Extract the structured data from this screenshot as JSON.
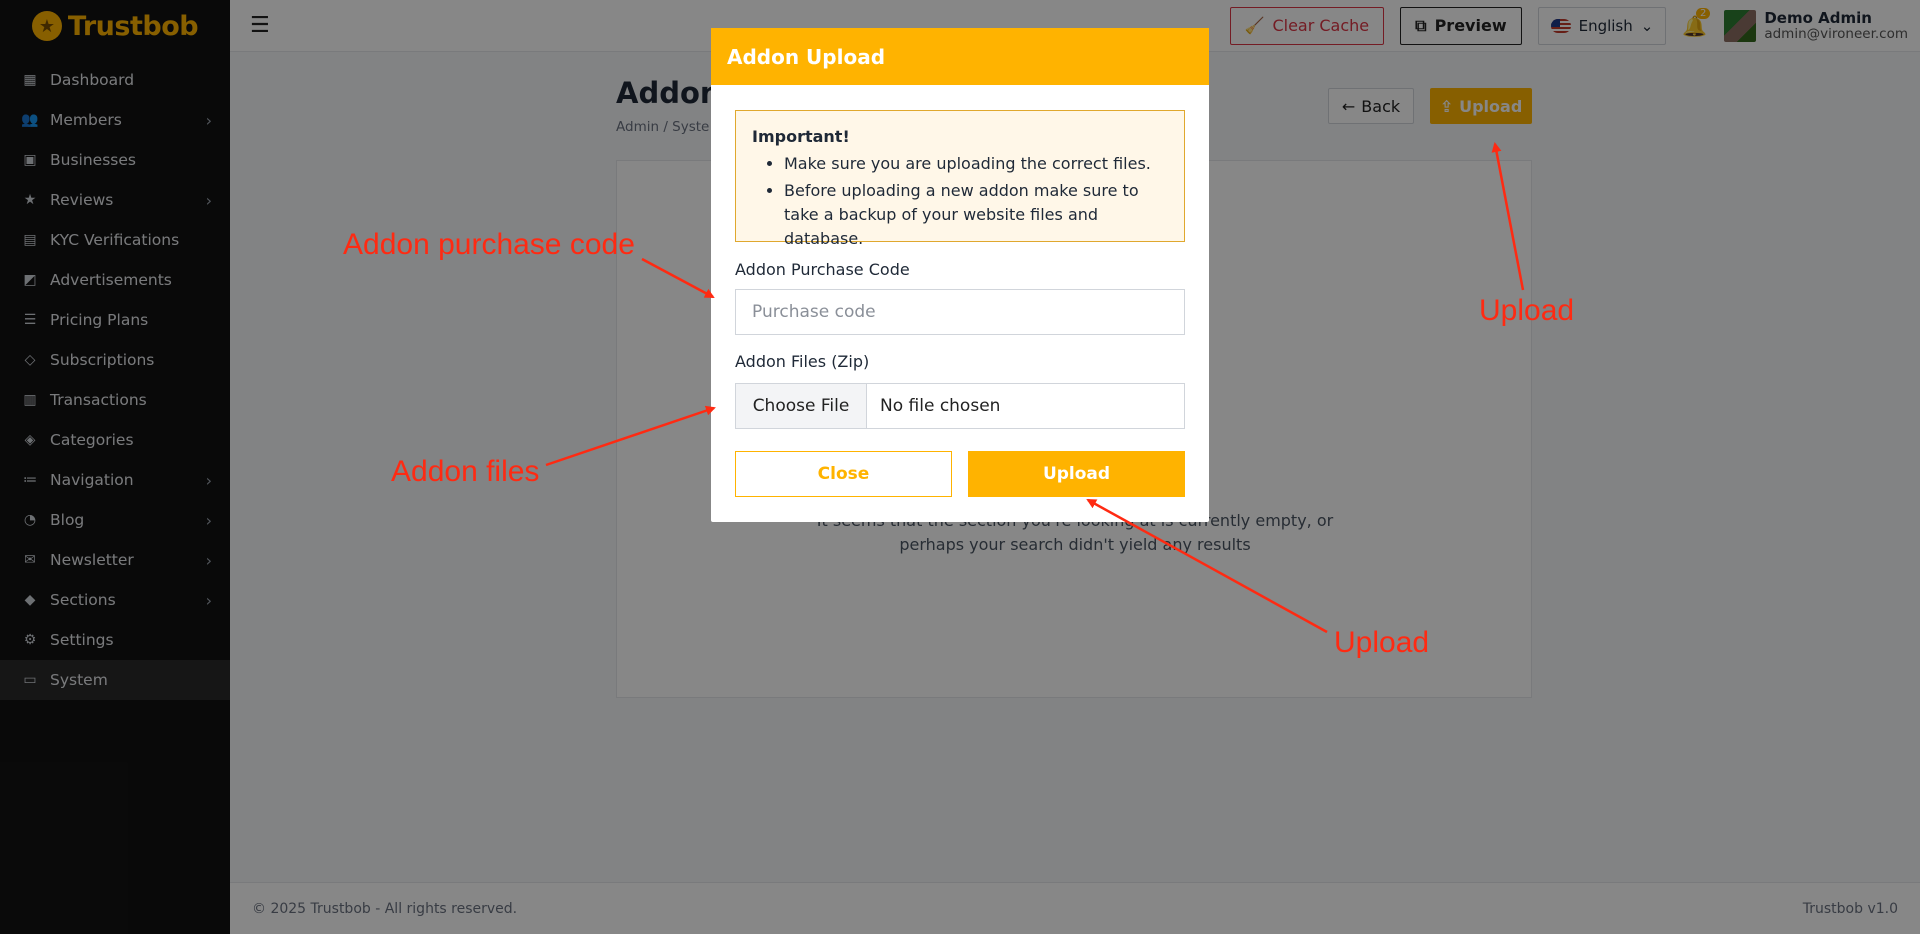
{
  "brand": {
    "name_part1": "Trust",
    "name_part2": "bob"
  },
  "sidebar": {
    "items": [
      {
        "label": "Dashboard",
        "icon": "dashboard-icon",
        "chevron": false
      },
      {
        "label": "Members",
        "icon": "users-icon",
        "chevron": true
      },
      {
        "label": "Businesses",
        "icon": "briefcase-icon",
        "chevron": false
      },
      {
        "label": "Reviews",
        "icon": "star-icon",
        "chevron": true
      },
      {
        "label": "KYC Verifications",
        "icon": "id-card-icon",
        "chevron": false
      },
      {
        "label": "Advertisements",
        "icon": "ad-icon",
        "chevron": false
      },
      {
        "label": "Pricing Plans",
        "icon": "price-list-icon",
        "chevron": false
      },
      {
        "label": "Subscriptions",
        "icon": "gem-icon",
        "chevron": false
      },
      {
        "label": "Transactions",
        "icon": "receipt-icon",
        "chevron": false
      },
      {
        "label": "Categories",
        "icon": "tags-icon",
        "chevron": false
      },
      {
        "label": "Navigation",
        "icon": "list-icon",
        "chevron": true
      },
      {
        "label": "Blog",
        "icon": "rss-icon",
        "chevron": true
      },
      {
        "label": "Newsletter",
        "icon": "mail-icon",
        "chevron": true
      },
      {
        "label": "Sections",
        "icon": "layers-icon",
        "chevron": true
      },
      {
        "label": "Settings",
        "icon": "gear-icon",
        "chevron": false
      },
      {
        "label": "System",
        "icon": "server-icon",
        "chevron": false,
        "active": true
      }
    ]
  },
  "topbar": {
    "clear_cache": "Clear Cache",
    "preview": "Preview",
    "language": "English",
    "notification_count": "2",
    "user_name": "Demo Admin",
    "user_email": "admin@vironeer.com"
  },
  "page": {
    "title": "Addon",
    "breadcrumb": "Admin  /  Syste",
    "back": "Back",
    "upload": "Upload",
    "empty_line1": "It seems that the section you're looking at is currently empty, or",
    "empty_line2": "perhaps your search didn't yield any results"
  },
  "modal": {
    "title": "Addon Upload",
    "alert_title": "Important!",
    "alert_items": [
      "Make sure you are uploading the correct files.",
      "Before uploading a new addon make sure to take a backup of your website files and database."
    ],
    "code_label": "Addon Purchase Code",
    "code_placeholder": "Purchase code",
    "files_label": "Addon Files (Zip)",
    "choose_file": "Choose File",
    "no_file": "No file chosen",
    "close": "Close",
    "upload": "Upload"
  },
  "footer": {
    "copyright": "© 2025 Trustbob - All rights reserved.",
    "version": "Trustbob v1.0"
  },
  "annotations": {
    "purchase_code": "Addon purchase code",
    "files": "Addon files",
    "upload_top": "Upload",
    "upload_modal": "Upload"
  },
  "colors": {
    "accent": "#ffb300",
    "danger": "#dc3545",
    "annotation": "#ff2a12",
    "sidebar": "#121212"
  }
}
